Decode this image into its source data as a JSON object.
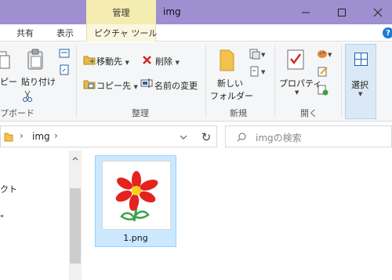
{
  "titlebar": {
    "context_tab": "管理",
    "title": "img"
  },
  "ribbon_tabs": {
    "share": "共有",
    "view": "表示",
    "picture_tools": "ピクチャ ツール",
    "help": "?"
  },
  "clipboard": {
    "copy_label": "ピー",
    "paste_label": "貼り付け",
    "group_label": "プボード"
  },
  "organize": {
    "move_to": "移動先",
    "copy_to": "コピー先",
    "delete": "削除",
    "rename": "名前の変更",
    "group_label": "整理"
  },
  "new_group": {
    "new_folder_line1": "新しい",
    "new_folder_line2": "フォルダー",
    "group_label": "新規"
  },
  "open_group": {
    "properties": "プロパティ",
    "group_label": "開く"
  },
  "select_group": {
    "select": "選択"
  },
  "address": {
    "path": "img"
  },
  "search": {
    "placeholder": "imgの検索"
  },
  "nav_pane": {
    "item1": "クト",
    "item2": "\""
  },
  "files": [
    {
      "name": "1.png"
    }
  ],
  "colors": {
    "titlebar": "#9e8fd0",
    "context_tab": "#f4ecb0",
    "selection": "#cce8ff"
  }
}
